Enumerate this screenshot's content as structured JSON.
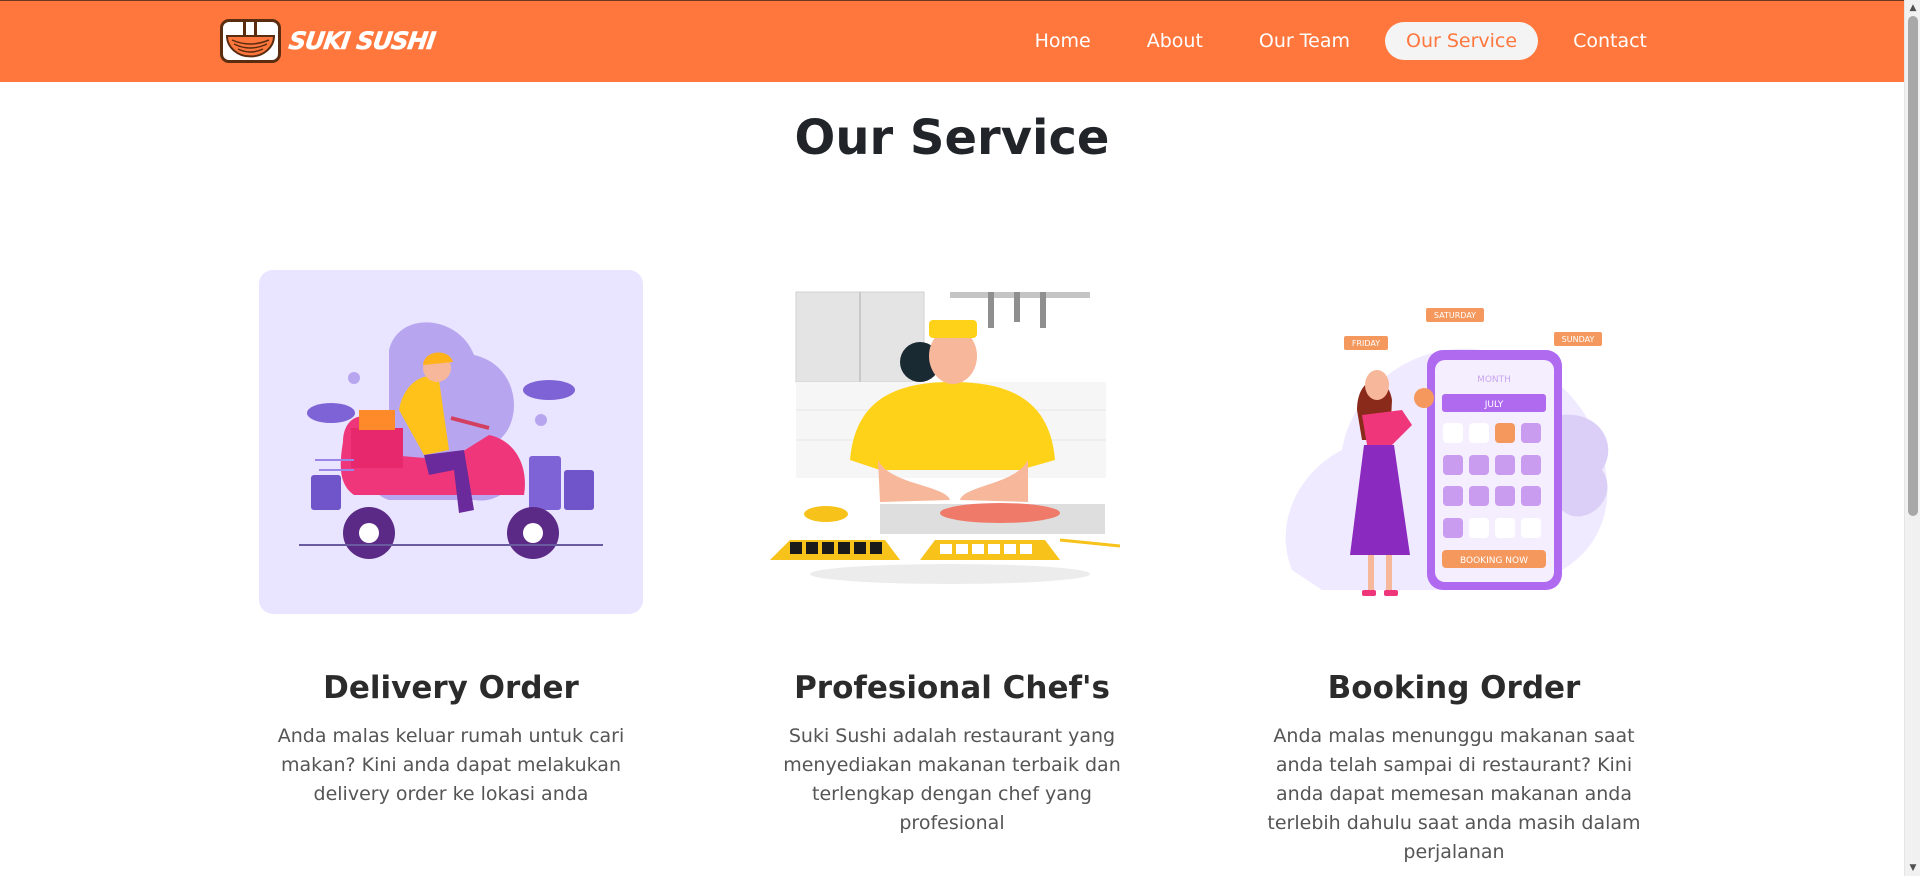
{
  "brand": {
    "name": "SUKI SUSHI"
  },
  "nav": {
    "items": [
      {
        "label": "Home"
      },
      {
        "label": "About"
      },
      {
        "label": "Our Team"
      },
      {
        "label": "Our Service",
        "active": true
      },
      {
        "label": "Contact"
      }
    ]
  },
  "section": {
    "title": "Our Service"
  },
  "cards": [
    {
      "title": "Delivery Order",
      "text": "Anda malas keluar rumah untuk cari makan? Kini anda dapat melakukan delivery order ke lokasi anda"
    },
    {
      "title": "Profesional Chef's",
      "text": "Suki Sushi adalah restaurant yang menyediakan makanan terbaik dan terlengkap dengan chef yang profesional"
    },
    {
      "title": "Booking Order",
      "text": "Anda malas menunggu makanan saat anda telah sampai di restaurant? Kini anda dapat memesan makanan anda terlebih dahulu saat anda masih dalam perjalanan",
      "illustration_labels": {
        "day1": "FRIDAY",
        "day2": "SATURDAY",
        "day3": "SUNDAY",
        "month": "MONTH",
        "month_name": "JULY",
        "button": "BOOKING NOW"
      }
    }
  ],
  "colors": {
    "brand": "#ff773d",
    "illustration_bg": "#e9e4ff"
  },
  "icons": {
    "logo": "ramen-bowl-icon",
    "scroll_up": "triangle-up-icon",
    "scroll_down": "triangle-down-icon"
  }
}
